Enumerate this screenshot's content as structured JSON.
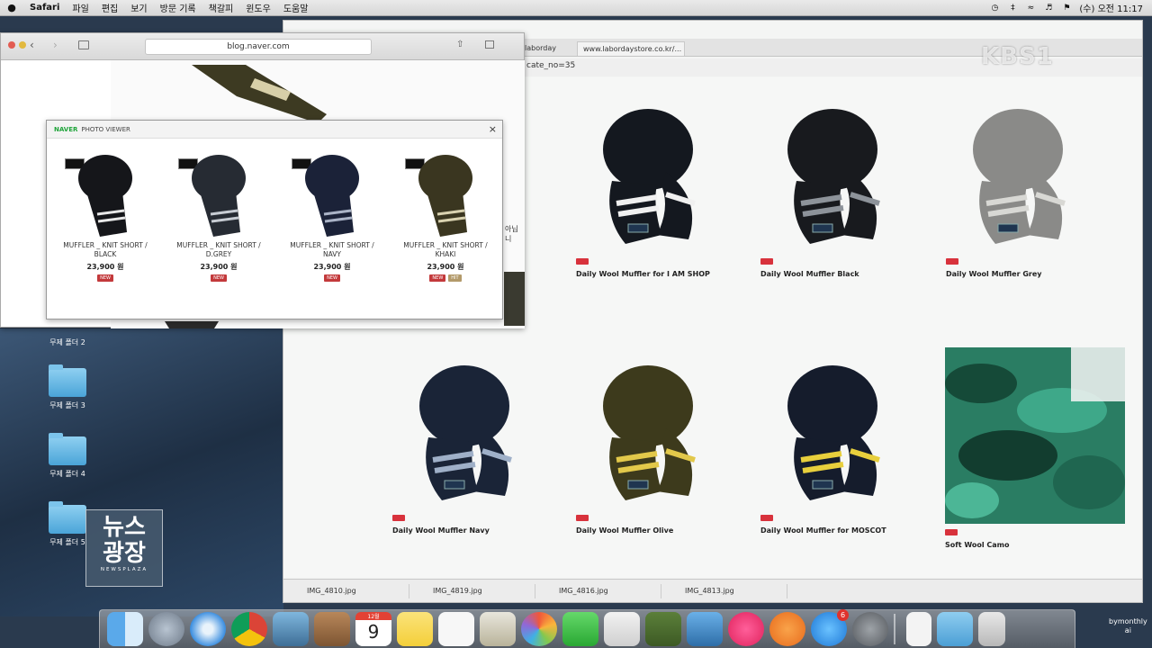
{
  "menubar": {
    "apple": "",
    "items": [
      "Safari",
      "파일",
      "편집",
      "보기",
      "방문 기록",
      "책갈피",
      "윈도우",
      "도움말"
    ],
    "clock": "(수) 오전 11:17"
  },
  "desktop": {
    "folders": [
      "무제 폴더 2",
      "무제 폴더 3",
      "무제 폴더 4",
      "무제 폴더 5"
    ]
  },
  "naver_window": {
    "address": "blog.naver.com",
    "side_text": "아닙니",
    "viewer": {
      "brand": "NAVER",
      "title": "PHOTO VIEWER",
      "close": "×",
      "items": [
        {
          "name": "MUFFLER _ KNIT SHORT / BLACK",
          "price": "23,900 원",
          "badges": [
            "NEW"
          ],
          "scarf_color": "#15161a",
          "stripe": "#e8e8e8"
        },
        {
          "name": "MUFFLER _ KNIT SHORT / D.GREY",
          "price": "23,900 원",
          "badges": [
            "NEW"
          ],
          "scarf_color": "#262b33",
          "stripe": "#c7ccd3"
        },
        {
          "name": "MUFFLER _ KNIT SHORT / NAVY",
          "price": "23,900 원",
          "badges": [
            "NEW"
          ],
          "scarf_color": "#1b2238",
          "stripe": "#aab3c6"
        },
        {
          "name": "MUFFLER _ KNIT SHORT / KHAKI",
          "price": "23,900 원",
          "badges": [
            "NEW",
            "HIT"
          ],
          "scarf_color": "#3a3620",
          "stripe": "#d9d2b0"
        }
      ]
    }
  },
  "store_window": {
    "tabs": [
      "laborday",
      "www.labordaystore.co.kr/..."
    ],
    "url": "cate_no=35",
    "products": [
      {
        "name": "Daily Wool Muffler for I AM SHOP",
        "color": "#14181f",
        "stripe": "#f0f0f0"
      },
      {
        "name": "Daily Wool Muffler Black",
        "color": "#181a1e",
        "stripe": "#8d939a"
      },
      {
        "name": "Daily Wool Muffler Grey",
        "color": "#8a8a88",
        "stripe": "#d8d8d4"
      },
      {
        "name": "Daily Wool Muffler Navy",
        "color": "#1a2437",
        "stripe": "#9fb0c8"
      },
      {
        "name": "Daily Wool Muffler Olive",
        "color": "#3d3a1c",
        "stripe": "#e2c84a"
      },
      {
        "name": "Daily Wool Muffler for MOSCOT",
        "color": "#151c2c",
        "stripe": "#e8cf3c"
      },
      {
        "name": "Soft Wool Camo",
        "color": "#2f8a6d",
        "stripe": "#144233"
      }
    ],
    "downloads": [
      "IMG_4810.jpg",
      "IMG_4819.jpg",
      "IMG_4816.jpg",
      "IMG_4813.jpg"
    ]
  },
  "dock": {
    "calendar_day": "9",
    "calendar_month": "12월",
    "appstore_badge": "6"
  },
  "overlay": {
    "channel": "KBS1",
    "program_big_1": "뉴스",
    "program_big_2": "광장",
    "program_small": "NEWSPLAZA",
    "credit_1": "bymonthly",
    "credit_2": "ai"
  }
}
